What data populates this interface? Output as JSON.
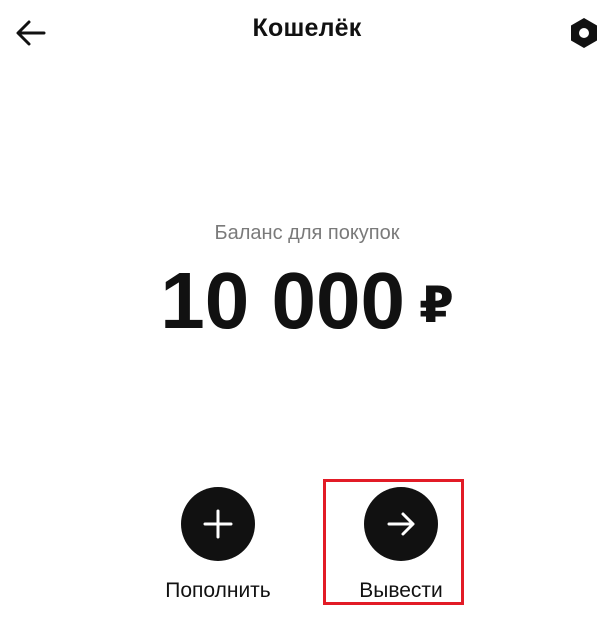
{
  "header": {
    "title": "Кошелёк",
    "back_icon": "arrow-left-icon",
    "settings_icon": "hexagon-settings-icon"
  },
  "balance": {
    "label": "Баланс для покупок",
    "amount": "10 000",
    "currency": "₽"
  },
  "actions": [
    {
      "label": "Пополнить",
      "icon": "plus-icon"
    },
    {
      "label": "Вывести",
      "icon": "arrow-right-icon",
      "highlighted": true
    }
  ],
  "colors": {
    "text": "#111111",
    "muted": "#7a7a7a",
    "highlight": "#e21b26",
    "background": "#ffffff"
  }
}
